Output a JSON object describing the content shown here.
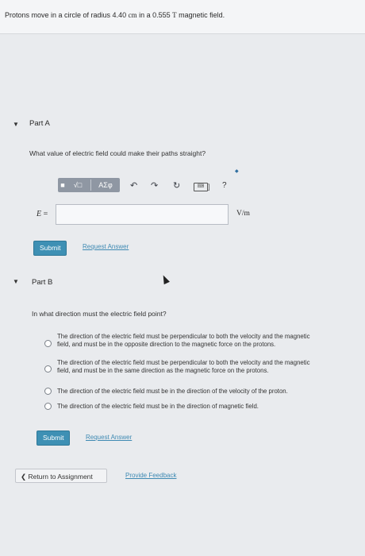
{
  "problem": {
    "text_before": "Protons move in a circle of radius 4.40 ",
    "radius_unit": "cm",
    "text_middle": " in a 0.555 ",
    "field_unit": "T",
    "text_after": " magnetic field."
  },
  "part_a": {
    "title": "Part A",
    "question": "What value of electric field could make their paths straight?",
    "toolbar": {
      "template_label": "√□",
      "greek_label": "AΣφ",
      "help_label": "?"
    },
    "variable": "E",
    "equals": "=",
    "input_value": "",
    "unit": "V/m",
    "submit_label": "Submit",
    "request_label": "Request Answer"
  },
  "part_b": {
    "title": "Part B",
    "question": "In what direction must the electric field point?",
    "options": [
      {
        "line1": "The direction of the electric field must be perpendicular to both the velocity and the magnetic",
        "line2": "field, and must be in the opposite direction to the magnetic force on the protons."
      },
      {
        "line1": "The direction of the electric field must be perpendicular to both the velocity and the magnetic",
        "line2": "field, and must be in the same direction as the magnetic force on the protons."
      },
      {
        "line1": "The direction of the electric field must be in the direction of the velocity of the proton.",
        "line2": ""
      },
      {
        "line1": "The direction of the electric field must be in the direction of magnetic field.",
        "line2": ""
      }
    ],
    "submit_label": "Submit",
    "request_label": "Request Answer"
  },
  "footer": {
    "return_label": "Return to Assignment",
    "feedback_label": "Provide Feedback"
  }
}
